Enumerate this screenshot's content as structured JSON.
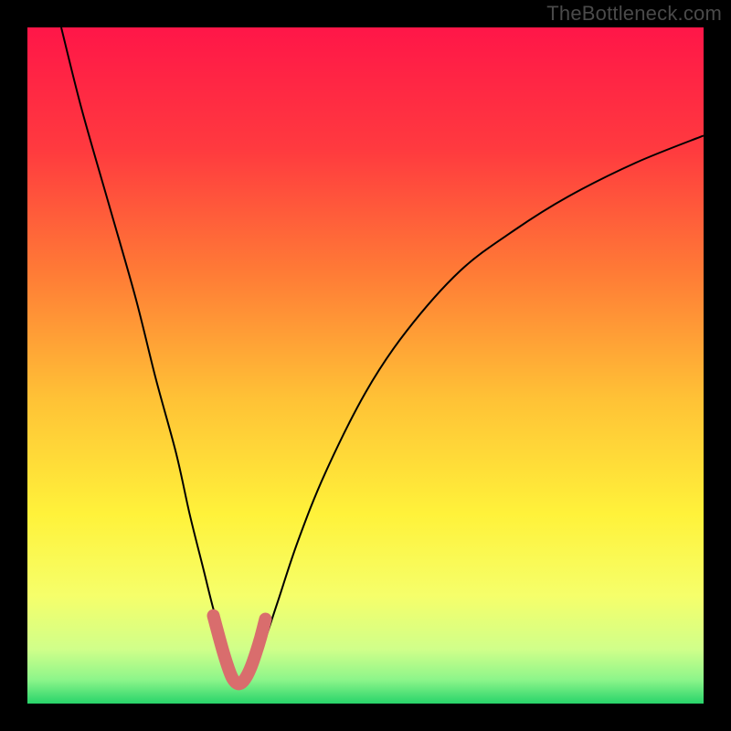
{
  "watermark": "TheBottleneck.com",
  "chart_data": {
    "type": "line",
    "title": "",
    "xlabel": "",
    "ylabel": "",
    "xlim": [
      0,
      100
    ],
    "ylim": [
      0,
      100
    ],
    "annotations": [],
    "series": [
      {
        "name": "curve",
        "color": "#000000",
        "x": [
          5,
          8,
          12,
          16,
          19,
          22,
          24,
          26,
          27.5,
          29,
          30,
          31,
          32,
          33.5,
          35,
          37,
          40,
          44,
          50,
          56,
          64,
          72,
          80,
          90,
          100
        ],
        "y": [
          100,
          88,
          74,
          60,
          48,
          37,
          28,
          20,
          14,
          9,
          5,
          3,
          3,
          5,
          9,
          15,
          24,
          34,
          46,
          55,
          64,
          70,
          75,
          80,
          84
        ]
      },
      {
        "name": "valley-highlight",
        "color": "#d96d6d",
        "x": [
          27.5,
          28.3,
          29,
          29.7,
          30.3,
          31,
          31.7,
          32.4,
          33.1,
          33.8,
          34.5,
          35.2
        ],
        "y": [
          13,
          10,
          7.5,
          5.3,
          3.8,
          3,
          3.1,
          4,
          5.5,
          7.5,
          9.8,
          12.5
        ]
      }
    ],
    "background_gradient": {
      "stops": [
        {
          "offset": 0.0,
          "color": "#ff1648"
        },
        {
          "offset": 0.18,
          "color": "#ff3a3f"
        },
        {
          "offset": 0.36,
          "color": "#ff7a36"
        },
        {
          "offset": 0.55,
          "color": "#ffc236"
        },
        {
          "offset": 0.72,
          "color": "#fff23a"
        },
        {
          "offset": 0.84,
          "color": "#f6ff6a"
        },
        {
          "offset": 0.92,
          "color": "#d0ff8a"
        },
        {
          "offset": 0.965,
          "color": "#8cf58a"
        },
        {
          "offset": 1.0,
          "color": "#28d46a"
        }
      ]
    },
    "highlight_style": {
      "stroke_width": 14,
      "linecap": "round"
    }
  }
}
